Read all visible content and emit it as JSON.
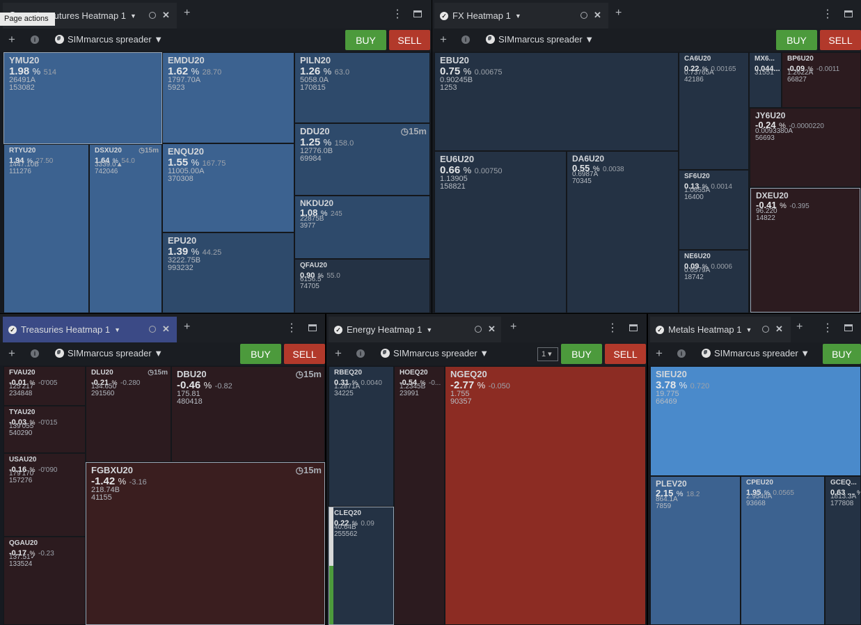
{
  "tooltip": "Page actions",
  "common": {
    "account": "SIMmarcus spreader",
    "buy": "BUY",
    "sell": "SELL",
    "minute_badge": "15m",
    "pct": "%"
  },
  "equity": {
    "tab": "Equity Futures Heatmap 1",
    "tiles": [
      {
        "sym": "YMU20",
        "chg": "1.98",
        "dv": "514",
        "l3": "26491A",
        "l4": "153082"
      },
      {
        "sym": "EMDU20",
        "chg": "1.62",
        "dv": "28.70",
        "l3": "1797.70A",
        "l4": "5923"
      },
      {
        "sym": "PILN20",
        "chg": "1.26",
        "dv": "63.0",
        "l3": "5058.0A",
        "l4": "170815"
      },
      {
        "sym": "DDU20",
        "chg": "1.25",
        "dv": "158.0",
        "l3": "12776.0B",
        "l4": "69984"
      },
      {
        "sym": "RTYU20",
        "chg": "1.94",
        "dv": "27.50",
        "l3": "1447.10B",
        "l4": "111276"
      },
      {
        "sym": "DSXU20",
        "chg": "1.64",
        "dv": "54.0",
        "l3": "3339.0▲",
        "l4": "742046"
      },
      {
        "sym": "ENQU20",
        "chg": "1.55",
        "dv": "167.75",
        "l3": "11005.00A",
        "l4": "370308"
      },
      {
        "sym": "NKDU20",
        "chg": "1.08",
        "dv": "245",
        "l3": "22875B",
        "l4": "3977"
      },
      {
        "sym": "EPU20",
        "chg": "1.39",
        "dv": "44.25",
        "l3": "3222.75B",
        "l4": "993232"
      },
      {
        "sym": "QFAU20",
        "chg": "0.90",
        "dv": "55.0",
        "l3": "6156.5",
        "l4": "74705"
      }
    ]
  },
  "fx": {
    "tab": "FX Heatmap 1",
    "tiles": [
      {
        "sym": "EBU20",
        "chg": "0.75",
        "dv": "0.00675",
        "l3": "0.90245B",
        "l4": "1253"
      },
      {
        "sym": "CA6U20",
        "chg": "0.22",
        "dv": "0.00165",
        "l3": "0.73765A",
        "l4": "42186"
      },
      {
        "sym": "MX6...",
        "chg": "0.044...",
        "dv": "",
        "l3": "31551",
        "l4": ""
      },
      {
        "sym": "BP6U20",
        "chg": "-0.09",
        "dv": "-0.0011",
        "l3": "1.2622A",
        "l4": "66827"
      },
      {
        "sym": "JY6U20",
        "chg": "-0.24",
        "dv": "-0.0000220",
        "l3": "0.0093380A",
        "l4": "56693"
      },
      {
        "sym": "EU6U20",
        "chg": "0.66",
        "dv": "0.00750",
        "l3": "1.13905",
        "l4": "158821"
      },
      {
        "sym": "DA6U20",
        "chg": "0.55",
        "dv": "0.0038",
        "l3": "0.6987A",
        "l4": "70345"
      },
      {
        "sym": "SF6U20",
        "chg": "0.13",
        "dv": "0.0014",
        "l3": "1.0655A",
        "l4": "16400"
      },
      {
        "sym": "DXEU20",
        "chg": "-0.41",
        "dv": "-0.395",
        "l3": "96.220",
        "l4": "14822"
      },
      {
        "sym": "NE6U20",
        "chg": "0.09",
        "dv": "0.0006",
        "l3": "0.6579A",
        "l4": "18742"
      }
    ]
  },
  "treasuries": {
    "tab": "Treasuries Heatmap 1",
    "tiles": [
      {
        "sym": "FVAU20",
        "chg": "-0.01",
        "dv": "-0'005",
        "l3": "125'217",
        "l4": "234848"
      },
      {
        "sym": "DLU20",
        "chg": "-0.21",
        "dv": "-0.280",
        "l3": "134.650",
        "l4": "291560"
      },
      {
        "sym": "DBU20",
        "chg": "-0.46",
        "dv": "-0.82",
        "l3": "175.81",
        "l4": "480418"
      },
      {
        "sym": "TYAU20",
        "chg": "-0.03",
        "dv": "-0'015",
        "l3": "139'055",
        "l4": "540290"
      },
      {
        "sym": "USAU20",
        "chg": "-0.16",
        "dv": "-0'090",
        "l3": "179'170",
        "l4": "157276"
      },
      {
        "sym": "FGBXU20",
        "chg": "-1.42",
        "dv": "-3.16",
        "l3": "218.74B",
        "l4": "41155"
      },
      {
        "sym": "QGAU20",
        "chg": "-0.17",
        "dv": "-0.23",
        "l3": "137.51✓",
        "l4": "133524"
      }
    ]
  },
  "energy": {
    "tab": "Energy Heatmap 1",
    "select": "1",
    "tiles": [
      {
        "sym": "RBEQ20",
        "chg": "0.31",
        "dv": "0.0040",
        "l3": "1.2871A",
        "l4": "34225"
      },
      {
        "sym": "HOEQ20",
        "chg": "-0.54",
        "dv": "-0...",
        "l3": "1.2345B",
        "l4": "23991"
      },
      {
        "sym": "NGEQ20",
        "chg": "-2.77",
        "dv": "-0.050",
        "l3": "1.755",
        "l4": "90357"
      },
      {
        "sym": "CLEQ20",
        "chg": "0.22",
        "dv": "0.09",
        "l3": "40.64B",
        "l4": "255562"
      }
    ]
  },
  "metals": {
    "tab": "Metals Heatmap 1",
    "tiles": [
      {
        "sym": "SIEU20",
        "chg": "3.78",
        "dv": "0.720",
        "l3": "19.775",
        "l4": "66469"
      },
      {
        "sym": "PLEV20",
        "chg": "2.15",
        "dv": "18.2",
        "l3": "864.1A",
        "l4": "7859"
      },
      {
        "sym": "CPEU20",
        "chg": "1.95",
        "dv": "0.0565",
        "l3": "2.9540A",
        "l4": "93668"
      },
      {
        "sym": "GCEQ...",
        "chg": "0.63 ...",
        "dv": "",
        "l3": "1813.3A",
        "l4": "177808"
      }
    ]
  },
  "colors": {
    "pos_strong": "#3c6290",
    "pos_mid": "#2e4a6b",
    "pos_dark": "#243244",
    "neg_dark": "#2c1b1f",
    "neg_mid": "#3a1e1f",
    "neg_red": "#8c2c23",
    "metal_bright": "#4a8acb"
  }
}
